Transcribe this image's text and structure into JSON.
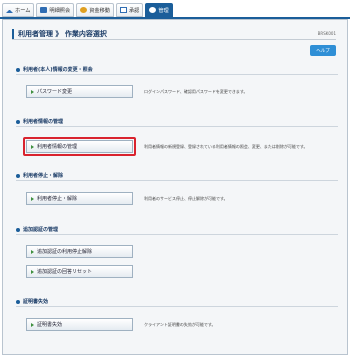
{
  "tabs": [
    {
      "label": "ホーム",
      "icon": "home-icon"
    },
    {
      "label": "明細照会",
      "icon": "document-icon"
    },
    {
      "label": "資金移動",
      "icon": "money-transfer-icon"
    },
    {
      "label": "承認",
      "icon": "approval-icon"
    },
    {
      "label": "管理",
      "icon": "admin-user-icon",
      "active": true
    }
  ],
  "header": {
    "title": "利用者管理 》 作業内容選択",
    "code": "BRSK001"
  },
  "help_label": "ヘルプ",
  "sections": [
    {
      "title": "利用者(本人)情報の変更・照会",
      "buttons": [
        {
          "label": "パスワード変更",
          "desc": "ログインパスワード、確認用パスワードを変更できます。"
        }
      ]
    },
    {
      "title": "利用者情報の管理",
      "buttons": [
        {
          "label": "利用者情報の管理",
          "desc": "利用者情報の新規登録、登録されている利用者情報の照会、変更、または削除が可能です。"
        }
      ]
    },
    {
      "title": "利用者停止・解除",
      "buttons": [
        {
          "label": "利用者停止・解除",
          "desc": "利用者のサービス停止、停止解除が可能です。"
        }
      ]
    },
    {
      "title": "追加認証の管理",
      "buttons": [
        {
          "label": "追加認証の利用停止解除",
          "desc": ""
        },
        {
          "label": "追加認証の回答リセット",
          "desc": ""
        }
      ]
    },
    {
      "title": "証明書失効",
      "buttons": [
        {
          "label": "証明書失効",
          "desc": "クライアント証明書の失効が可能です。"
        }
      ]
    }
  ],
  "colors": {
    "accent": "#1b5e9a",
    "highlight": "#d9232e",
    "help": "#2f8fd6"
  }
}
